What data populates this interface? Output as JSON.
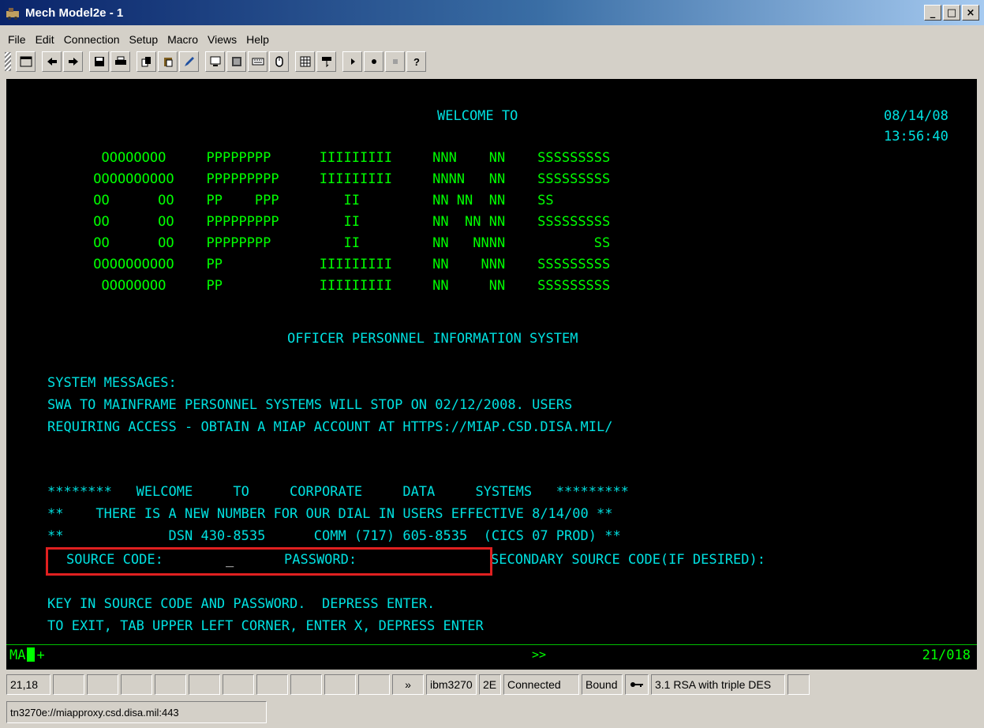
{
  "window": {
    "title": "Mech Model2e - 1",
    "minimize": "_",
    "maximize": "□",
    "close": "×"
  },
  "menu": [
    "File",
    "Edit",
    "Connection",
    "Setup",
    "Macro",
    "Views",
    "Help"
  ],
  "toolbar_icons": [
    "window-icon",
    "back-arrow-icon",
    "forward-arrow-icon",
    "save-icon",
    "print-icon",
    "copy-icon",
    "paste-icon",
    "edit-icon",
    "monitor-icon",
    "screen-icon",
    "keyboard-icon",
    "mouse-icon",
    "grid-icon",
    "hotspot-icon",
    "play-icon",
    "record-icon",
    "stop-icon",
    "help-icon"
  ],
  "terminal": {
    "welcome": "WELCOME TO",
    "date": "08/14/08",
    "time": "13:56:40",
    "banner": [
      "  OOOOOOOO     PPPPPPPP      IIIIIIIII     NNN    NN    SSSSSSSSS",
      " OOOOOOOOOO    PPPPPPPPP     IIIIIIIII     NNNN   NN    SSSSSSSSS",
      " OO      OO    PP    PPP        II         NN NN  NN    SS",
      " OO      OO    PPPPPPPPP        II         NN  NN NN    SSSSSSSSS",
      " OO      OO    PPPPPPPP         II         NN   NNNN           SS",
      " OOOOOOOOOO    PP            IIIIIIIII     NN    NNN    SSSSSSSSS",
      "  OOOOOOOO     PP            IIIIIIIII     NN     NN    SSSSSSSSS"
    ],
    "system_name": "OFFICER PERSONNEL INFORMATION SYSTEM",
    "messages_header": "SYSTEM MESSAGES:",
    "message_1": "SWA TO MAINFRAME PERSONNEL SYSTEMS WILL STOP ON 02/12/2008. USERS",
    "message_2": "REQUIRING ACCESS - OBTAIN A MIAP ACCOUNT AT HTTPS://MIAP.CSD.DISA.MIL/",
    "cds_line_1": "********   WELCOME     TO     CORPORATE     DATA     SYSTEMS   *********",
    "cds_line_2": "**    THERE IS A NEW NUMBER FOR OUR DIAL IN USERS EFFECTIVE 8/14/00 **",
    "cds_line_3": "**             DSN 430-8535      COMM (717) 605-8535  (CICS 07 PROD) **",
    "source_code_label": "SOURCE CODE:",
    "source_code_value": "_",
    "password_label": "PASSWORD:",
    "secondary_label": "SECONDARY SOURCE CODE(IF DESIRED):",
    "instruction_1": "KEY IN SOURCE CODE AND PASSWORD.  DEPRESS ENTER.",
    "instruction_2": "TO EXIT, TAB UPPER LEFT CORNER, ENTER X, DEPRESS ENTER",
    "oia_left": "MA",
    "oia_plus": "+",
    "oia_mid": ">>",
    "oia_right": "21/018"
  },
  "status": {
    "cursor_pos": "21,18",
    "arrows": "»",
    "terminal_type": "ibm3270",
    "model": "2E",
    "connection": "Connected",
    "bound": "Bound",
    "encryption": "3.1 RSA with triple DES",
    "url": "tn3270e://miapproxy.csd.disa.mil:443"
  }
}
